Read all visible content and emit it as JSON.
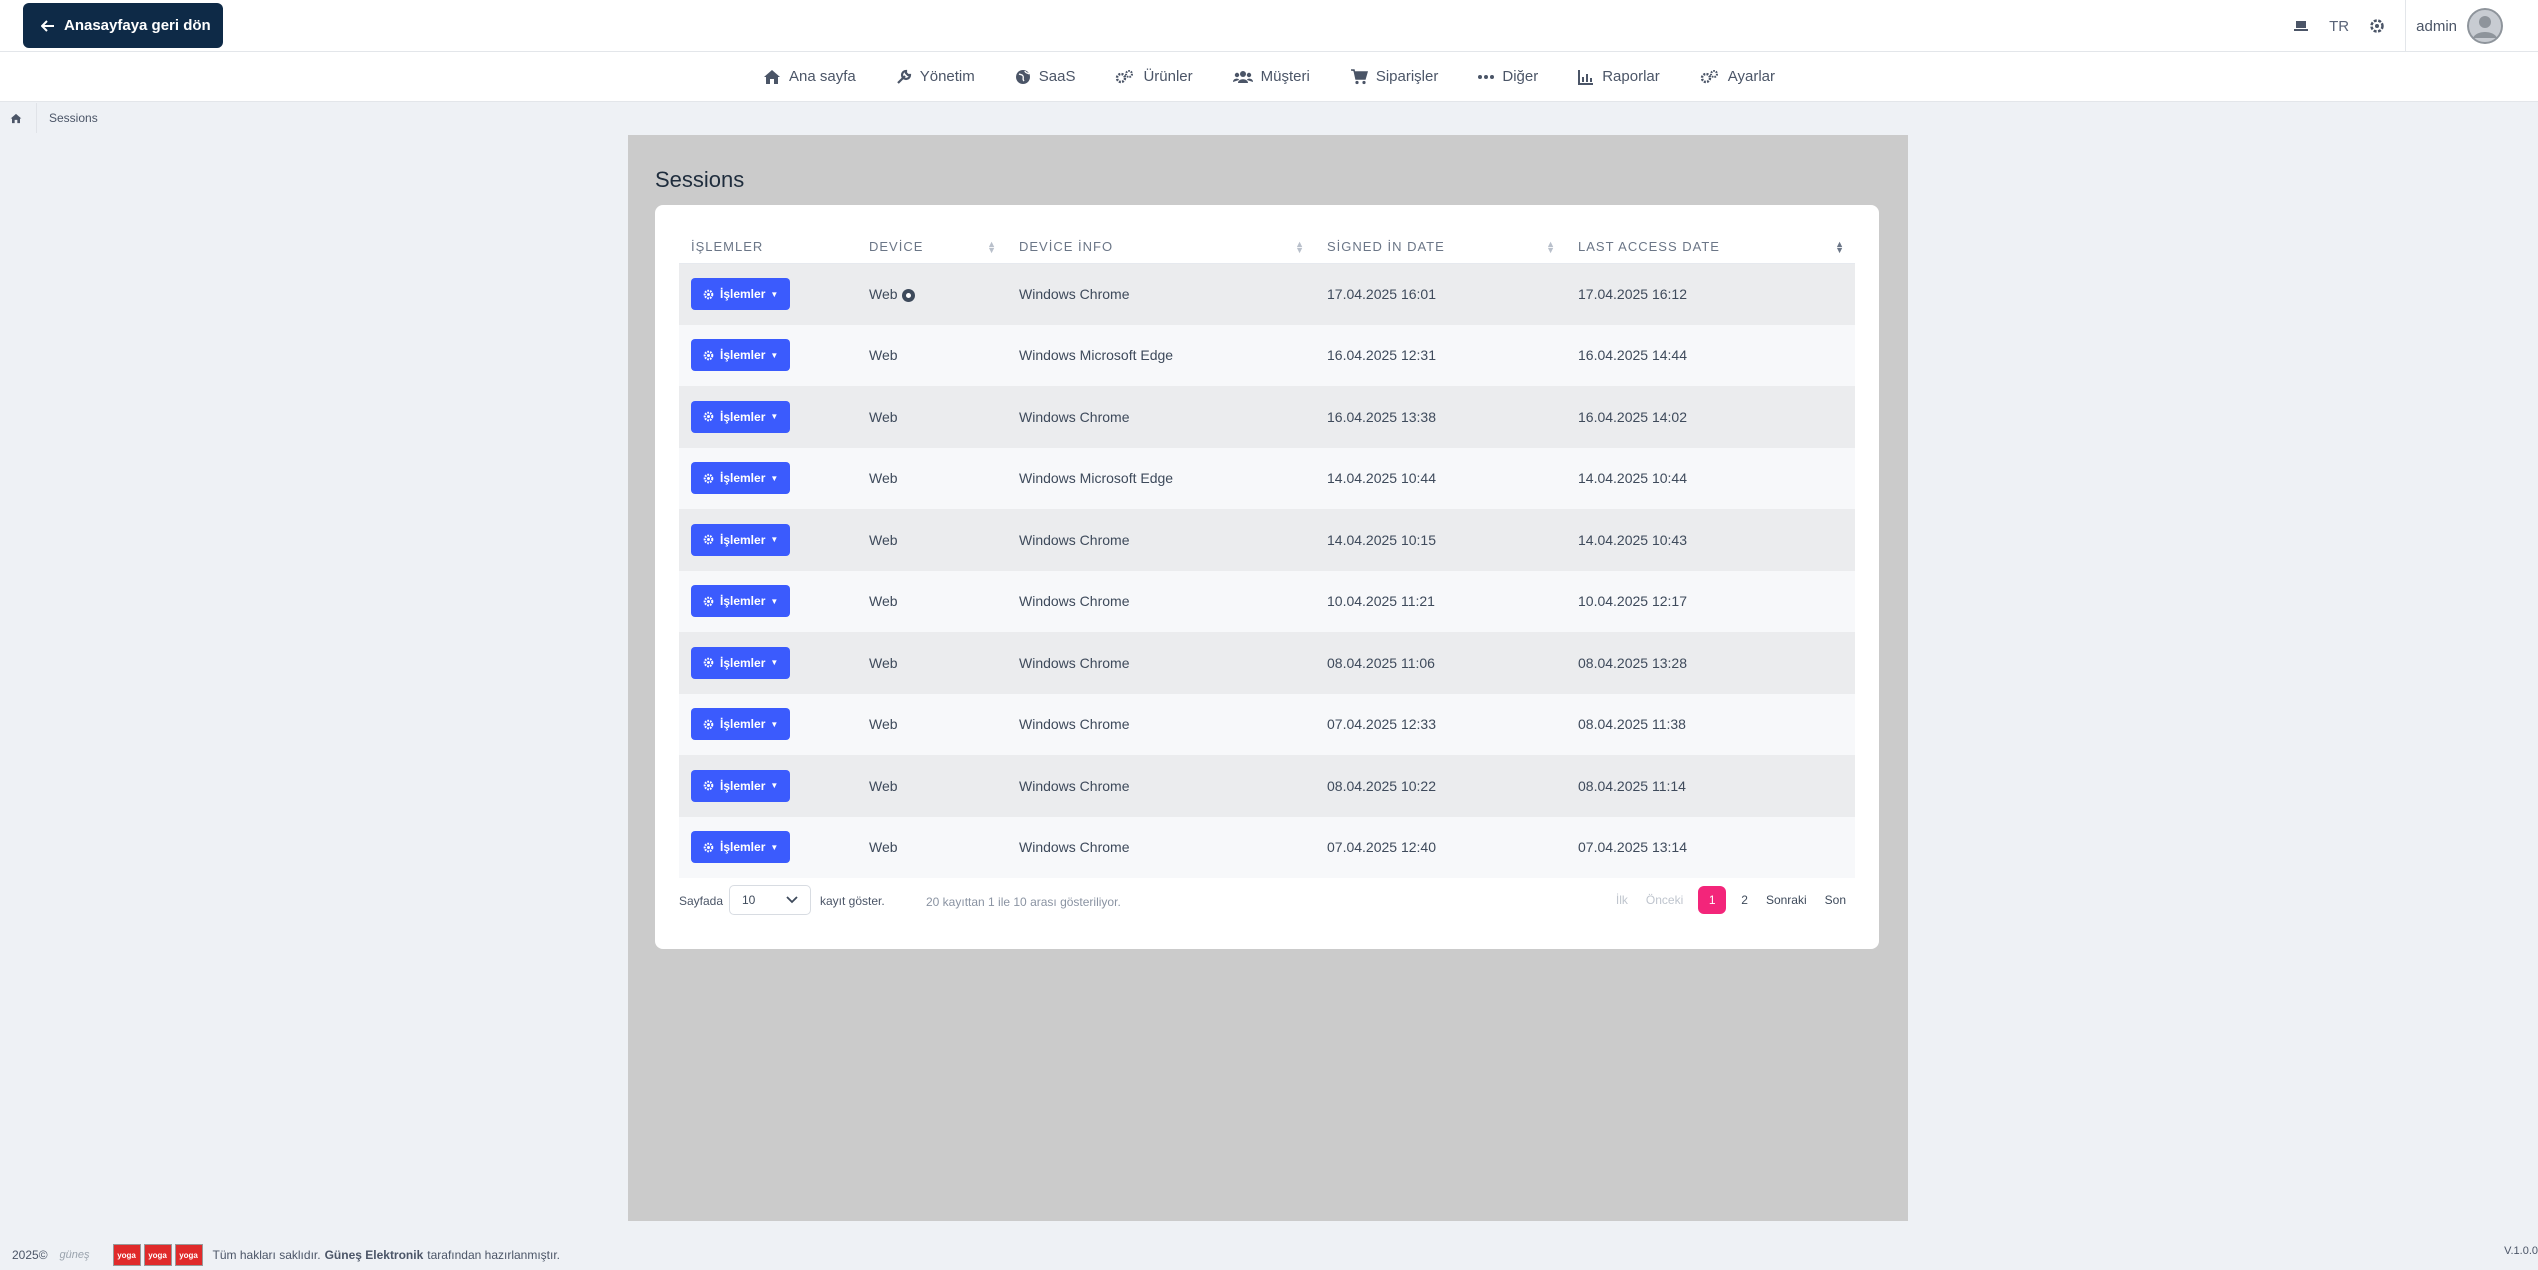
{
  "topbar": {
    "back_label": "Anasayfaya geri dön",
    "lang": "TR",
    "username": "admin"
  },
  "menu": [
    {
      "label": "Ana sayfa",
      "icon": "home-icon"
    },
    {
      "label": "Yönetim",
      "icon": "wrench-icon"
    },
    {
      "label": "SaaS",
      "icon": "globe-icon"
    },
    {
      "label": "Ürünler",
      "icon": "gears-icon"
    },
    {
      "label": "Müşteri",
      "icon": "users-icon"
    },
    {
      "label": "Siparişler",
      "icon": "cart-icon"
    },
    {
      "label": "Diğer",
      "icon": "ellipsis-icon"
    },
    {
      "label": "Raporlar",
      "icon": "chart-icon"
    },
    {
      "label": "Ayarlar",
      "icon": "gears-icon"
    }
  ],
  "breadcrumb": {
    "current": "Sessions"
  },
  "page": {
    "title": "Sessions"
  },
  "table": {
    "headers": [
      "İŞLEMLER",
      "DEVİCE",
      "DEVİCE İNFO",
      "SİGNED İN DATE",
      "LAST ACCESS DATE"
    ],
    "action_label": "İşlemler",
    "rows": [
      {
        "device": "Web",
        "info": "Windows Chrome",
        "signed": "17.04.2025 16:01",
        "last": "17.04.2025 16:12",
        "current": true
      },
      {
        "device": "Web",
        "info": "Windows Microsoft Edge",
        "signed": "16.04.2025 12:31",
        "last": "16.04.2025 14:44"
      },
      {
        "device": "Web",
        "info": "Windows Chrome",
        "signed": "16.04.2025 13:38",
        "last": "16.04.2025 14:02"
      },
      {
        "device": "Web",
        "info": "Windows Microsoft Edge",
        "signed": "14.04.2025 10:44",
        "last": "14.04.2025 10:44"
      },
      {
        "device": "Web",
        "info": "Windows Chrome",
        "signed": "14.04.2025 10:15",
        "last": "14.04.2025 10:43"
      },
      {
        "device": "Web",
        "info": "Windows Chrome",
        "signed": "10.04.2025 11:21",
        "last": "10.04.2025 12:17"
      },
      {
        "device": "Web",
        "info": "Windows Chrome",
        "signed": "08.04.2025 11:06",
        "last": "08.04.2025 13:28"
      },
      {
        "device": "Web",
        "info": "Windows Chrome",
        "signed": "07.04.2025 12:33",
        "last": "08.04.2025 11:38"
      },
      {
        "device": "Web",
        "info": "Windows Chrome",
        "signed": "08.04.2025 10:22",
        "last": "08.04.2025 11:14"
      },
      {
        "device": "Web",
        "info": "Windows Chrome",
        "signed": "07.04.2025 12:40",
        "last": "07.04.2025 13:14"
      }
    ]
  },
  "pagination": {
    "per_page_label": "Sayfada",
    "per_page_value": "10",
    "per_page_suffix": "kayıt göster.",
    "info": "20 kayıttan 1 ile 10 arası gösteriliyor.",
    "first": "İlk",
    "prev": "Önceki",
    "pages": [
      "1",
      "2"
    ],
    "next": "Sonraki",
    "last": "Son"
  },
  "footer": {
    "year": "2025©",
    "brand_logo": "güneş",
    "badge": "yoga",
    "text_prefix": "Tüm hakları saklıdır.",
    "company": "Güneş Elektronik",
    "text_suffix": "tarafından hazırlanmıştır.",
    "version": "V.1.0.0"
  },
  "colors": {
    "accent": "#3b5bfd",
    "active_page": "#f3257a",
    "back_button": "#0e2a47"
  }
}
